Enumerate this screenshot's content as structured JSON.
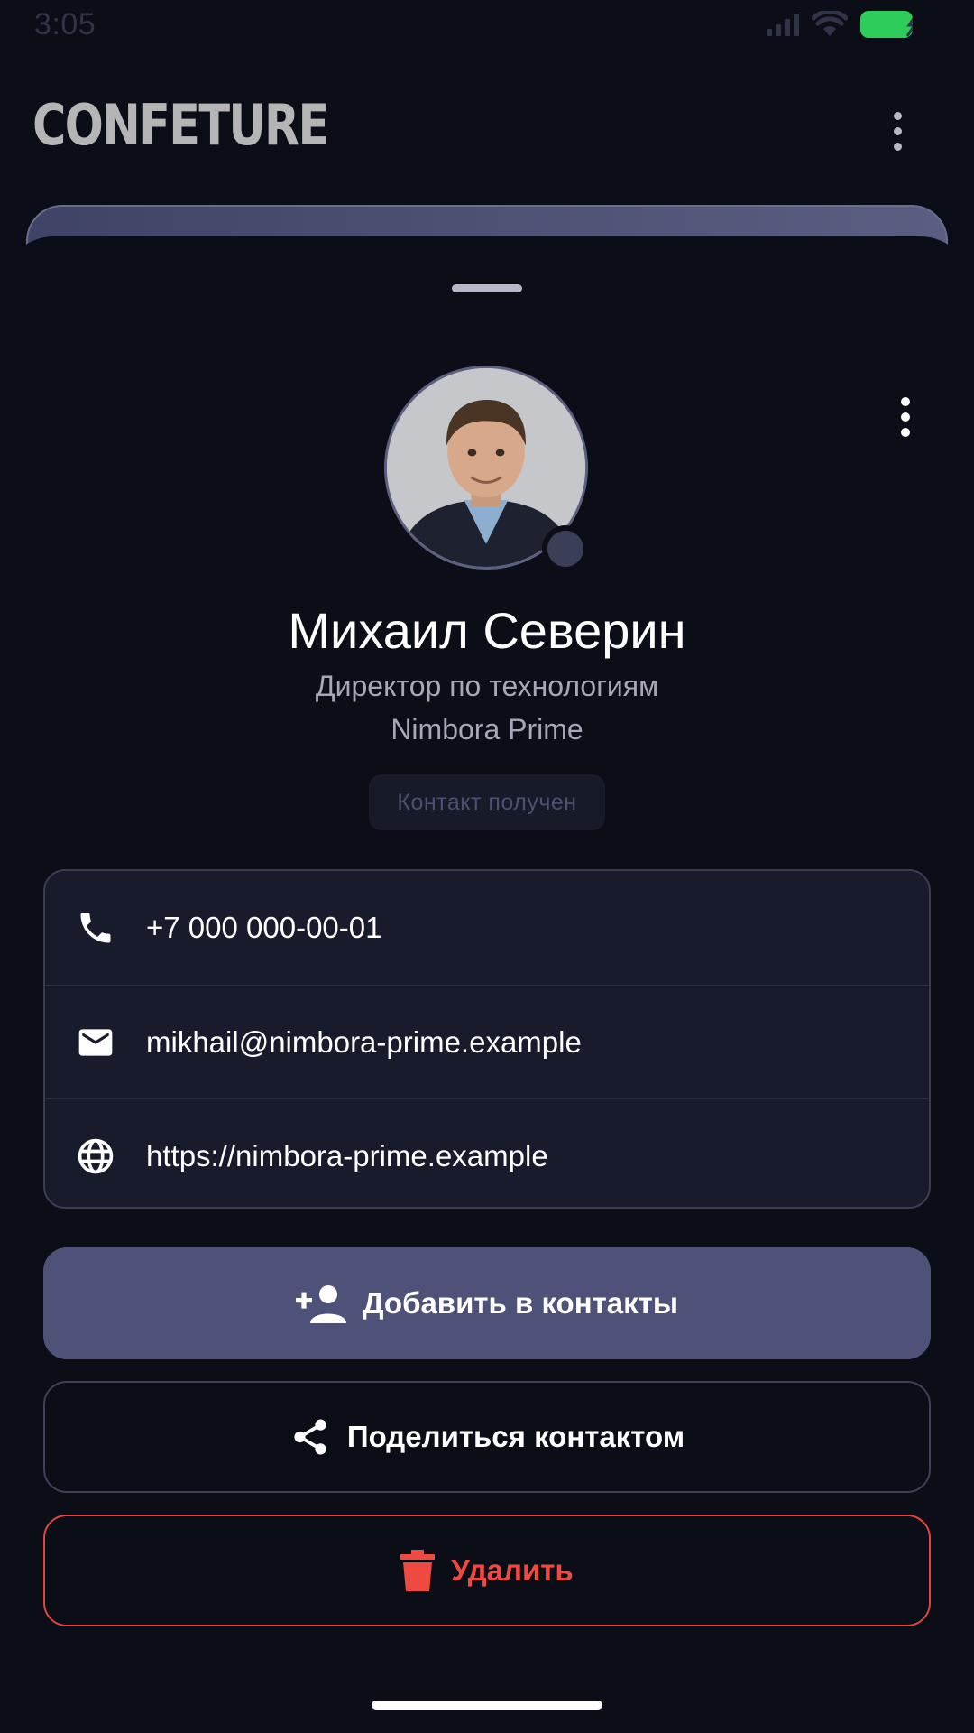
{
  "status_bar": {
    "time": "3:05"
  },
  "app_header": {
    "logo_text": "CONFETURE"
  },
  "contact": {
    "name": "Михаил Северин",
    "title": "Директор по технологиям",
    "company": "Nimbora Prime",
    "badge": "Контакт получен"
  },
  "info": {
    "phone": "+7 000 000-00-01",
    "email": "mikhail@nimbora-prime.example",
    "website": "https://nimbora-prime.example"
  },
  "actions": {
    "add_label": "Добавить в контакты",
    "share_label": "Поделиться контактом",
    "delete_label": "Удалить"
  },
  "colors": {
    "background": "#0b0d17",
    "primary_button": "#4f5278",
    "danger": "#ef4a42",
    "battery": "#2ecc5a"
  },
  "icons": {
    "status": [
      "cellular-signal-icon",
      "wifi-icon",
      "battery-charging-icon"
    ],
    "info": [
      "phone-icon",
      "email-icon",
      "globe-icon"
    ],
    "actions": [
      "person-add-icon",
      "share-icon",
      "trash-icon"
    ]
  }
}
